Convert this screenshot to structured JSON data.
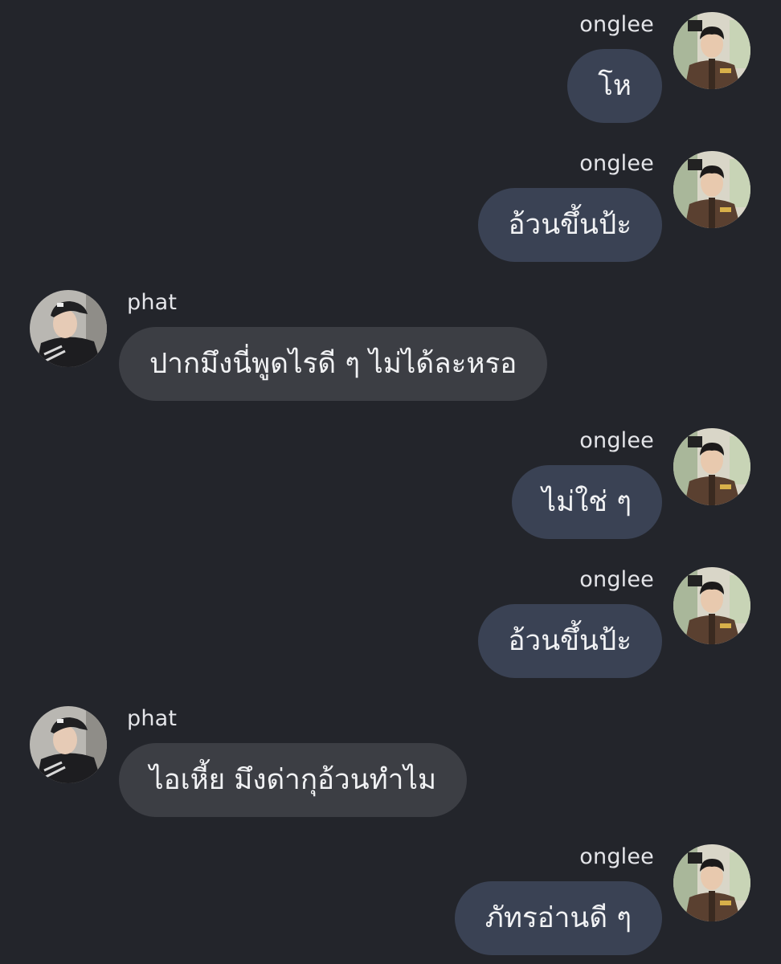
{
  "chat": {
    "messages": [
      {
        "sender": "onglee",
        "side": "right",
        "text": "โห"
      },
      {
        "sender": "onglee",
        "side": "right",
        "text": "อ้วนขึ้นป้ะ"
      },
      {
        "sender": "phat",
        "side": "left",
        "text": "ปากมึงนี่พูดไรดี ๆ ไม่ได้ละหรอ"
      },
      {
        "sender": "onglee",
        "side": "right",
        "text": "ไม่ใช่ ๆ"
      },
      {
        "sender": "onglee",
        "side": "right",
        "text": "อ้วนขึ้นป้ะ"
      },
      {
        "sender": "phat",
        "side": "left",
        "text": "ไอเหี้ย มึงด่ากุอ้วนทำไม"
      },
      {
        "sender": "onglee",
        "side": "right",
        "text": "ภัทรอ่านดี ๆ"
      }
    ]
  },
  "colors": {
    "background": "#23252b",
    "bubble_self": "#3a4254",
    "bubble_other": "#3c3e44",
    "text": "#f1f2f4"
  },
  "icons": {
    "onglee_avatar": "avatar-photo-uniform",
    "phat_avatar": "avatar-photo-cap"
  }
}
